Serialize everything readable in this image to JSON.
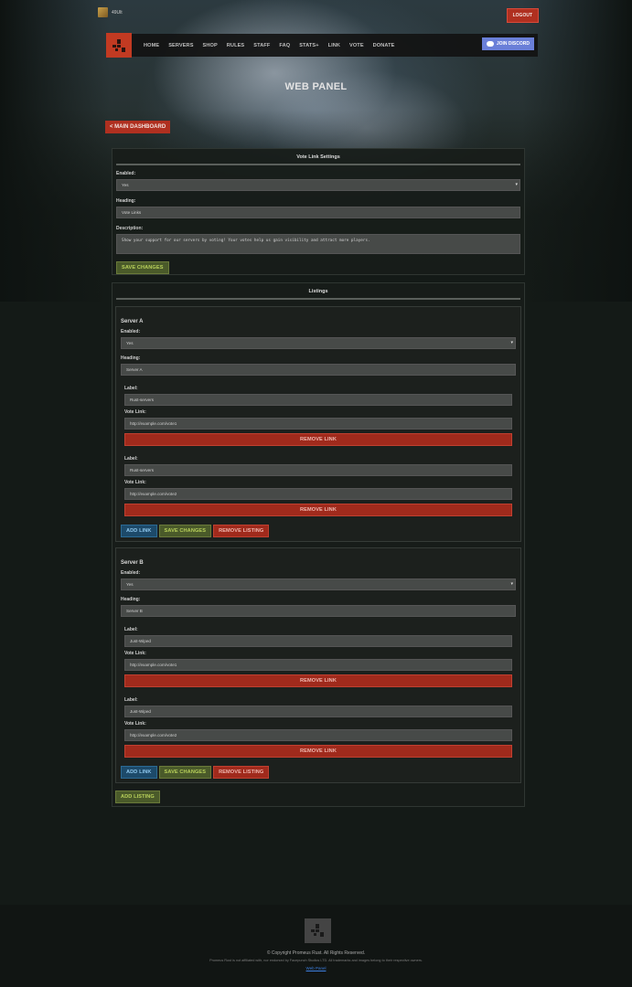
{
  "user": {
    "name": "49Ult"
  },
  "topbar": {
    "logout_label": "LOGOUT"
  },
  "nav": {
    "items": [
      "HOME",
      "SERVERS",
      "SHOP",
      "RULES",
      "STAFF",
      "FAQ",
      "STATS+",
      "LINK",
      "VOTE",
      "DONATE"
    ],
    "discord_label": "JOIN DISCORD"
  },
  "page": {
    "title": "WEB PANEL",
    "back_label": "< MAIN DASHBOARD"
  },
  "settings": {
    "title": "Vote Link Settings",
    "enabled_label": "Enabled:",
    "enabled_value": "Yes",
    "heading_label": "Heading:",
    "heading_value": "Vote Links",
    "description_label": "Description:",
    "description_value": "Show your support for our servers by voting! Your votes help us gain visibility and attract more players.",
    "save_label": "SAVE CHANGES"
  },
  "listings": {
    "title": "Listings",
    "enabled_label": "Enabled:",
    "heading_label": "Heading:",
    "label_label": "Label:",
    "vote_link_label": "Vote Link:",
    "remove_link_label": "REMOVE LINK",
    "add_link_label": "ADD LINK",
    "save_label": "SAVE CHANGES",
    "remove_listing_label": "REMOVE LISTING",
    "add_listing_label": "ADD LISTING",
    "items": [
      {
        "name": "Server A",
        "enabled": "Yes",
        "heading": "Server A",
        "links": [
          {
            "label": "Rust-servers",
            "url": "http://example.com/vote1"
          },
          {
            "label": "Rust-servers",
            "url": "http://example.com/vote2"
          }
        ]
      },
      {
        "name": "Server B",
        "enabled": "Yes",
        "heading": "Server B",
        "links": [
          {
            "label": "Just-Wiped",
            "url": "http://example.com/vote1"
          },
          {
            "label": "Just-Wiped",
            "url": "http://example.com/vote2"
          }
        ]
      }
    ]
  },
  "footer": {
    "copyright": "© Copyright Promeus Rust. All Rights Reserved.",
    "disclaimer": "Promeus Rust is not affiliated with, nor endorsed by Facepunch Studios LTD. All trademarks and images belong to their respective owners.",
    "link_label": "Web Panel"
  },
  "colors": {
    "accent_red": "#b03020",
    "save_green": "#4a5a2a",
    "add_blue": "#1d4a6a",
    "discord": "#6a7fd8"
  }
}
